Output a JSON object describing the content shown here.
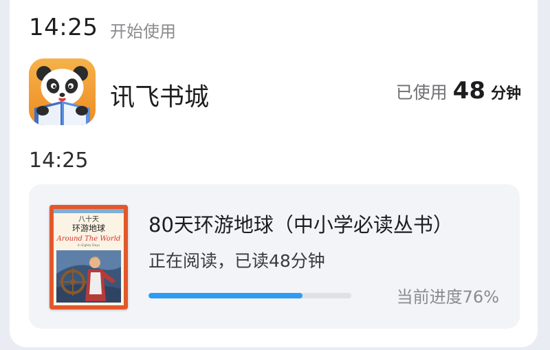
{
  "session": {
    "time": "14:25",
    "label": "开始使用"
  },
  "app": {
    "name": "讯飞书城",
    "icon": "panda-reading-book-app-icon",
    "usage_label": "已使用",
    "usage_value": "48",
    "usage_unit": "分钟"
  },
  "activity": {
    "time": "14:25",
    "book": {
      "cover": {
        "title_line1": "八十天",
        "title_line2": "环游地球",
        "en_title": "Around The World",
        "en_subtitle": "In Eighty Days",
        "icon": "book-cover-image"
      },
      "title": "80天环游地球（中小学必读丛书）",
      "status": "正在阅读，已读48分钟",
      "progress_label": "当前进度76%",
      "progress": 0.76
    }
  },
  "colors": {
    "accent": "#2d9cf2",
    "track": "#dfe1e7",
    "card_bg": "#f3f4f8",
    "app_icon_bg": "#f0931f",
    "cover_bg": "#e2582a"
  }
}
